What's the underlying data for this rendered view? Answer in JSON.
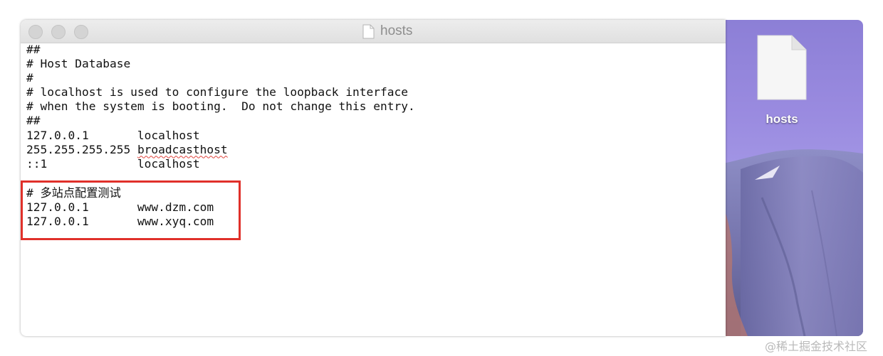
{
  "window": {
    "title": "hosts",
    "traffic_lights": [
      "close",
      "minimize",
      "zoom"
    ],
    "title_icon": "document-icon"
  },
  "editor": {
    "lines": [
      "##",
      "# Host Database",
      "#",
      "# localhost is used to configure the loopback interface",
      "# when the system is booting.  Do not change this entry.",
      "##",
      "127.0.0.1       localhost",
      "255.255.255.255 ",
      "::1             localhost",
      "",
      "# 多站点配置测试",
      "127.0.0.1       www.dzm.com",
      "127.0.0.1       www.xyq.com"
    ],
    "misspelled_word": "broadcasthost"
  },
  "desktop": {
    "file_icon_label": "hosts",
    "file_icon": "document-icon"
  },
  "watermark": "@稀土掘金技术社区",
  "colors": {
    "highlight_box": "#e0302a",
    "spell_underline": "#e0413a"
  }
}
